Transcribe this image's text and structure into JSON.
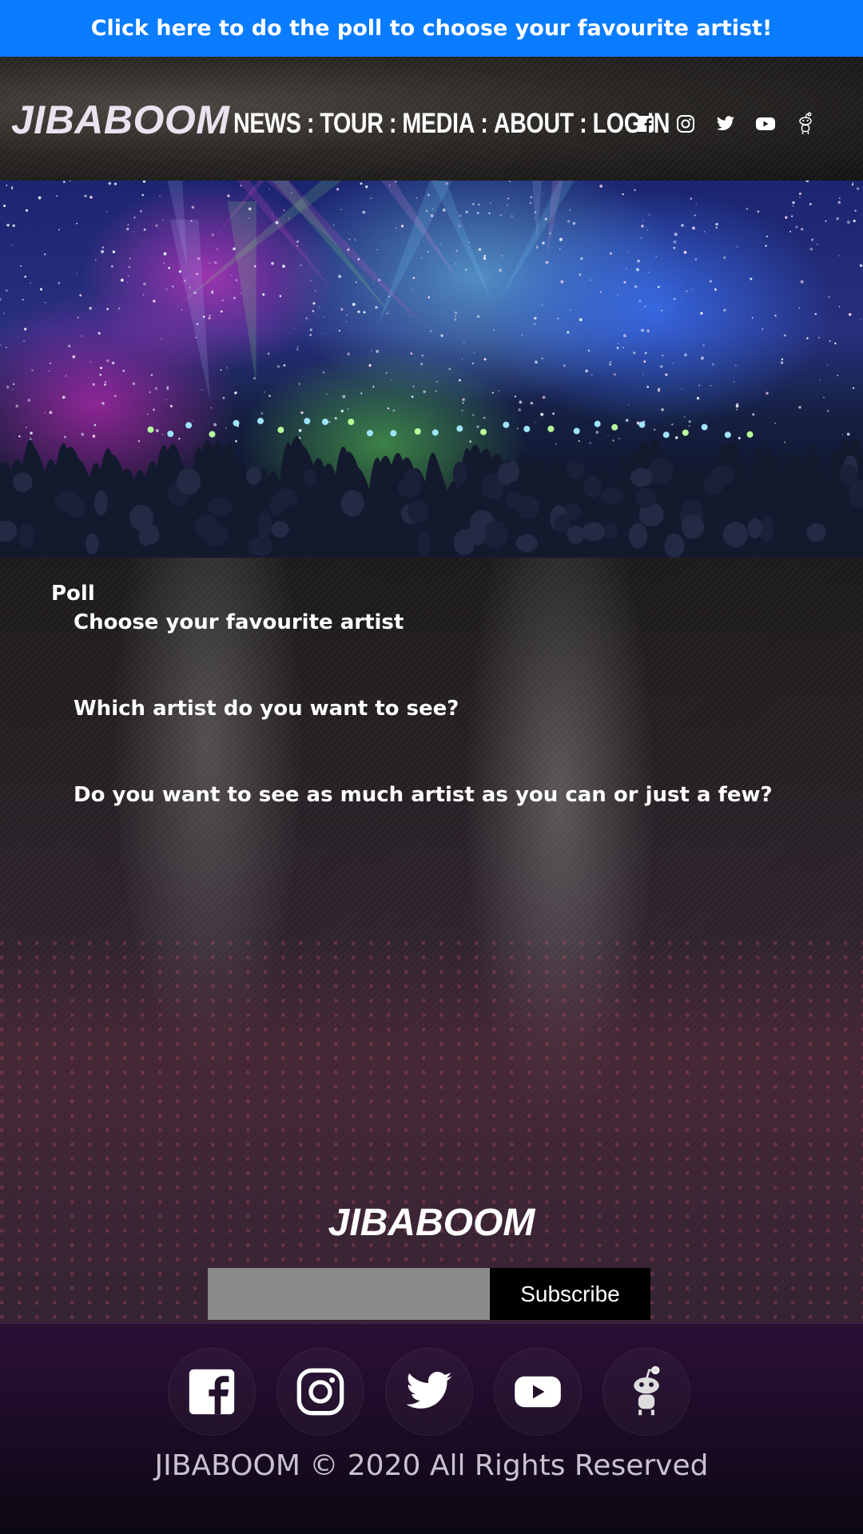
{
  "banner": {
    "text": "Click here to do the poll to choose your favourite artist!"
  },
  "header": {
    "logo": "JIBABOOM",
    "nav": [
      {
        "label": "NEWS"
      },
      {
        "label": "TOUR"
      },
      {
        "label": "MEDIA"
      },
      {
        "label": "ABOUT"
      },
      {
        "label": "LOG IN"
      }
    ],
    "separator": ":",
    "social_icons": [
      "facebook-icon",
      "instagram-icon",
      "twitter-icon",
      "youtube-icon",
      "reddit-icon"
    ]
  },
  "poll": {
    "title": "Poll",
    "questions": [
      "Choose your favourite artist",
      "Which artist do you want to see?",
      "Do you want to see as much artist as you can or just a few?"
    ]
  },
  "subscribe": {
    "logo": "JIBABOOM",
    "input_value": "",
    "button_label": "Subscribe"
  },
  "footer": {
    "social_icons": [
      "facebook-icon",
      "instagram-icon",
      "twitter-icon",
      "youtube-icon",
      "reddit-icon"
    ],
    "copyright": "JIBABOOM © 2020 All Rights Reserved"
  },
  "colors": {
    "banner": "#0a7cff",
    "footer": "#2b0f35",
    "subscribe_button": "#000000",
    "email_input": "#8a8a8a"
  }
}
